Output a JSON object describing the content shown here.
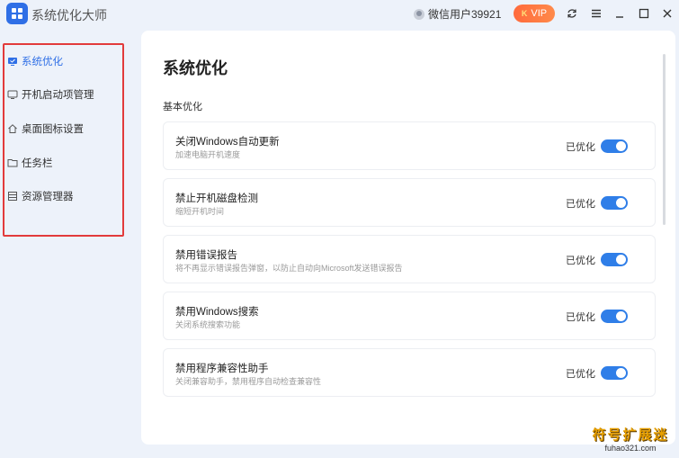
{
  "app": {
    "title": "系统优化大师"
  },
  "titlebar": {
    "user": "微信用户39921",
    "vip_label": "VIP",
    "vip_k": "K"
  },
  "sidebar": {
    "items": [
      {
        "label": "系统优化",
        "icon": "monitor-badge-icon",
        "active": true
      },
      {
        "label": "开机启动项管理",
        "icon": "monitor-icon"
      },
      {
        "label": "桌面图标设置",
        "icon": "home-icon"
      },
      {
        "label": "任务栏",
        "icon": "folder-icon"
      },
      {
        "label": "资源管理器",
        "icon": "list-icon"
      }
    ]
  },
  "main": {
    "title": "系统优化",
    "section": "基本优化",
    "items": [
      {
        "title": "关闭Windows自动更新",
        "desc": "加速电脑开机速度",
        "status": "已优化",
        "enabled": true
      },
      {
        "title": "禁止开机磁盘检测",
        "desc": "缩短开机时间",
        "status": "已优化",
        "enabled": true
      },
      {
        "title": "禁用错误报告",
        "desc": "将不再显示错误报告弹窗，以防止自动向Microsoft发送错误报告",
        "status": "已优化",
        "enabled": true
      },
      {
        "title": "禁用Windows搜索",
        "desc": "关闭系统搜索功能",
        "status": "已优化",
        "enabled": true
      },
      {
        "title": "禁用程序兼容性助手",
        "desc": "关闭兼容助手，禁用程序自动检查兼容性",
        "status": "已优化",
        "enabled": true
      }
    ]
  },
  "watermark": {
    "main": "符号扩展迷",
    "sub": "fuhao321.com"
  },
  "colors": {
    "accent": "#2f6fe6",
    "toggle": "#2f7ee8",
    "vip": "#ff6a3c",
    "highlight": "#e23b3b"
  }
}
